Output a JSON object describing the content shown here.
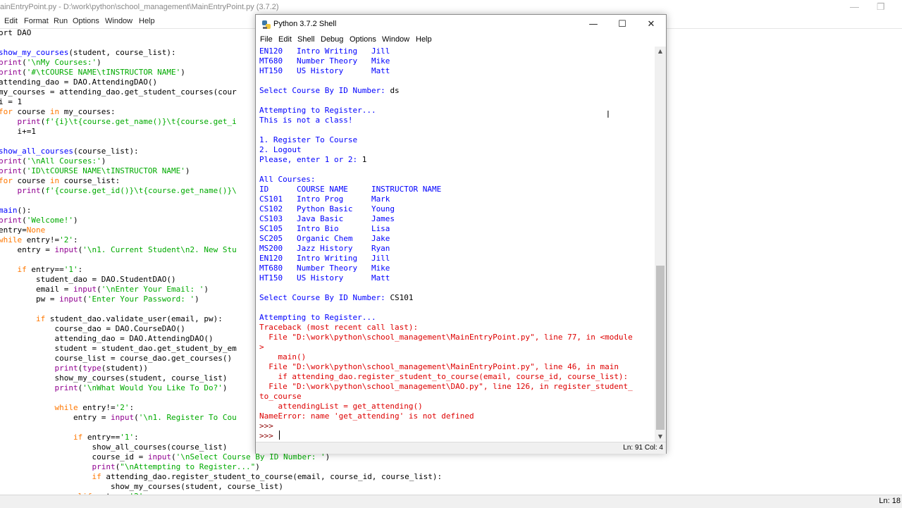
{
  "editor": {
    "title": "ainEntryPoint.py - D:\\work\\python\\school_management\\MainEntryPoint.py (3.7.2)",
    "window_controls": {
      "minimize": "—",
      "restore": "❐"
    },
    "menu": [
      "Edit",
      "Format",
      "Run",
      "Options",
      "Window",
      "Help"
    ],
    "code_lines": [
      [
        [
          "ort DAO",
          ""
        ]
      ],
      [
        [
          "",
          ""
        ]
      ],
      [
        [
          "show_my_courses",
          "df"
        ],
        [
          "(student, course_list):",
          ""
        ]
      ],
      [
        [
          "print",
          "bi"
        ],
        [
          "(",
          ""
        ],
        [
          "'\\nMy Courses:'",
          "st"
        ],
        [
          ")",
          ""
        ]
      ],
      [
        [
          "print",
          "bi"
        ],
        [
          "(",
          ""
        ],
        [
          "'#\\tCOURSE NAME\\tINSTRUCTOR NAME'",
          "st"
        ],
        [
          ")",
          ""
        ]
      ],
      [
        [
          "attending_dao = DAO.AttendingDAO()",
          ""
        ]
      ],
      [
        [
          "my_courses = attending_dao.get_student_courses(cour",
          ""
        ]
      ],
      [
        [
          "i = 1",
          ""
        ]
      ],
      [
        [
          "for",
          "kw"
        ],
        [
          " course ",
          ""
        ],
        [
          "in",
          "kw"
        ],
        [
          " my_courses:",
          ""
        ]
      ],
      [
        [
          "    ",
          ""
        ],
        [
          "print",
          "bi"
        ],
        [
          "(",
          ""
        ],
        [
          "f'{i}\\t{course.get_name()}\\t{course.get_i",
          "st"
        ]
      ],
      [
        [
          "    i+=1",
          ""
        ]
      ],
      [
        [
          "",
          ""
        ]
      ],
      [
        [
          "show_all_courses",
          "df"
        ],
        [
          "(course_list):",
          ""
        ]
      ],
      [
        [
          "print",
          "bi"
        ],
        [
          "(",
          ""
        ],
        [
          "'\\nAll Courses:'",
          "st"
        ],
        [
          ")",
          ""
        ]
      ],
      [
        [
          "print",
          "bi"
        ],
        [
          "(",
          ""
        ],
        [
          "'ID\\tCOURSE NAME\\tINSTRUCTOR NAME'",
          "st"
        ],
        [
          ")",
          ""
        ]
      ],
      [
        [
          "for",
          "kw"
        ],
        [
          " course ",
          ""
        ],
        [
          "in",
          "kw"
        ],
        [
          " course_list:",
          ""
        ]
      ],
      [
        [
          "    ",
          ""
        ],
        [
          "print",
          "bi"
        ],
        [
          "(",
          ""
        ],
        [
          "f'{course.get_id()}\\t{course.get_name()}\\",
          "st"
        ]
      ],
      [
        [
          "",
          ""
        ]
      ],
      [
        [
          "main",
          "df"
        ],
        [
          "():",
          ""
        ]
      ],
      [
        [
          "print",
          "bi"
        ],
        [
          "(",
          ""
        ],
        [
          "'Welcome!'",
          "st"
        ],
        [
          ")",
          ""
        ]
      ],
      [
        [
          "entry=",
          ""
        ],
        [
          "None",
          "kw"
        ]
      ],
      [
        [
          "while",
          "kw"
        ],
        [
          " entry!=",
          ""
        ],
        [
          "'2'",
          "st"
        ],
        [
          ":",
          ""
        ]
      ],
      [
        [
          "    entry = ",
          ""
        ],
        [
          "input",
          "bi"
        ],
        [
          "(",
          ""
        ],
        [
          "'\\n1. Current Student\\n2. New Stu",
          "st"
        ]
      ],
      [
        [
          "",
          ""
        ]
      ],
      [
        [
          "    ",
          ""
        ],
        [
          "if",
          "kw"
        ],
        [
          " entry==",
          ""
        ],
        [
          "'1'",
          "st"
        ],
        [
          ":",
          ""
        ]
      ],
      [
        [
          "        student_dao = DAO.StudentDAO()",
          ""
        ]
      ],
      [
        [
          "        email = ",
          ""
        ],
        [
          "input",
          "bi"
        ],
        [
          "(",
          ""
        ],
        [
          "'\\nEnter Your Email: '",
          "st"
        ],
        [
          ")",
          ""
        ]
      ],
      [
        [
          "        pw = ",
          ""
        ],
        [
          "input",
          "bi"
        ],
        [
          "(",
          ""
        ],
        [
          "'Enter Your Password: '",
          "st"
        ],
        [
          ")",
          ""
        ]
      ],
      [
        [
          "",
          ""
        ]
      ],
      [
        [
          "        ",
          ""
        ],
        [
          "if",
          "kw"
        ],
        [
          " student_dao.validate_user(email, pw):",
          ""
        ]
      ],
      [
        [
          "            course_dao = DAO.CourseDAO()",
          ""
        ]
      ],
      [
        [
          "            attending_dao = DAO.AttendingDAO()",
          ""
        ]
      ],
      [
        [
          "            student = student_dao.get_student_by_em",
          ""
        ]
      ],
      [
        [
          "            course_list = course_dao.get_courses()",
          ""
        ]
      ],
      [
        [
          "            ",
          ""
        ],
        [
          "print",
          "bi"
        ],
        [
          "(",
          ""
        ],
        [
          "type",
          "bi"
        ],
        [
          "(student))",
          ""
        ]
      ],
      [
        [
          "            show_my_courses(student, course_list)",
          ""
        ]
      ],
      [
        [
          "            ",
          ""
        ],
        [
          "print",
          "bi"
        ],
        [
          "(",
          ""
        ],
        [
          "'\\nWhat Would You Like To Do?'",
          "st"
        ],
        [
          ")",
          ""
        ]
      ],
      [
        [
          "",
          ""
        ]
      ],
      [
        [
          "            ",
          ""
        ],
        [
          "while",
          "kw"
        ],
        [
          " entry!=",
          ""
        ],
        [
          "'2'",
          "st"
        ],
        [
          ":",
          ""
        ]
      ],
      [
        [
          "                entry = ",
          ""
        ],
        [
          "input",
          "bi"
        ],
        [
          "(",
          ""
        ],
        [
          "'\\n1. Register To Cou",
          "st"
        ]
      ],
      [
        [
          "",
          ""
        ]
      ],
      [
        [
          "                ",
          ""
        ],
        [
          "if",
          "kw"
        ],
        [
          " entry==",
          ""
        ],
        [
          "'1'",
          "st"
        ],
        [
          ":",
          ""
        ]
      ],
      [
        [
          "                    show_all_courses(course_list)",
          ""
        ]
      ],
      [
        [
          "                    course_id = ",
          ""
        ],
        [
          "input",
          "bi"
        ],
        [
          "(",
          ""
        ],
        [
          "'\\nSelect Course By ID Number: '",
          "st"
        ],
        [
          ")",
          ""
        ]
      ],
      [
        [
          "                    ",
          ""
        ],
        [
          "print",
          "bi"
        ],
        [
          "(",
          ""
        ],
        [
          "\"\\nAttempting to Register...\"",
          "st"
        ],
        [
          ")",
          ""
        ]
      ],
      [
        [
          "                    ",
          ""
        ],
        [
          "if",
          "kw"
        ],
        [
          " attending_dao.register_student_to_course(email, course_id, course_list):",
          ""
        ]
      ],
      [
        [
          "                        show_my_courses(student, course_list)",
          ""
        ]
      ],
      [
        [
          "                ",
          ""
        ],
        [
          "elif",
          "kw"
        ],
        [
          " entry==",
          ""
        ],
        [
          "'2'",
          "st"
        ],
        [
          ":",
          ""
        ]
      ]
    ],
    "status_text": "Ln: 18"
  },
  "shell": {
    "title": "Python 3.7.2 Shell",
    "window_controls": {
      "minimize": "—",
      "maximize": "☐",
      "close": "✕"
    },
    "menu": [
      "File",
      "Edit",
      "Shell",
      "Debug",
      "Options",
      "Window",
      "Help"
    ],
    "output_lines": [
      [
        [
          "EN120   Intro Writing   Jill",
          "o"
        ]
      ],
      [
        [
          "MT680   Number Theory   Mike",
          "o"
        ]
      ],
      [
        [
          "HT150   US History      Matt",
          "o"
        ]
      ],
      [
        [
          "",
          ""
        ]
      ],
      [
        [
          "Select Course By ID Number: ",
          "o"
        ],
        [
          "ds",
          "ip"
        ]
      ],
      [
        [
          "",
          ""
        ]
      ],
      [
        [
          "Attempting to Register...",
          "o"
        ]
      ],
      [
        [
          "This is not a class!",
          "o"
        ]
      ],
      [
        [
          "",
          ""
        ]
      ],
      [
        [
          "1. Register To Course",
          "o"
        ]
      ],
      [
        [
          "2. Logout",
          "o"
        ]
      ],
      [
        [
          "Please, enter 1 or 2: ",
          "o"
        ],
        [
          "1",
          "ip"
        ]
      ],
      [
        [
          "",
          ""
        ]
      ],
      [
        [
          "All Courses:",
          "o"
        ]
      ],
      [
        [
          "ID      COURSE NAME     INSTRUCTOR NAME",
          "o"
        ]
      ],
      [
        [
          "CS101   Intro Prog      Mark",
          "o"
        ]
      ],
      [
        [
          "CS102   Python Basic    Young",
          "o"
        ]
      ],
      [
        [
          "CS103   Java Basic      James",
          "o"
        ]
      ],
      [
        [
          "SC105   Intro Bio       Lisa",
          "o"
        ]
      ],
      [
        [
          "SC205   Organic Chem    Jake",
          "o"
        ]
      ],
      [
        [
          "MS200   Jazz History    Ryan",
          "o"
        ]
      ],
      [
        [
          "EN120   Intro Writing   Jill",
          "o"
        ]
      ],
      [
        [
          "MT680   Number Theory   Mike",
          "o"
        ]
      ],
      [
        [
          "HT150   US History      Matt",
          "o"
        ]
      ],
      [
        [
          "",
          ""
        ]
      ],
      [
        [
          "Select Course By ID Number: ",
          "o"
        ],
        [
          "CS101",
          "ip"
        ]
      ],
      [
        [
          "",
          ""
        ]
      ],
      [
        [
          "Attempting to Register...",
          "o"
        ]
      ],
      [
        [
          "Traceback (most recent call last):",
          "er"
        ]
      ],
      [
        [
          "  File \"D:\\work\\python\\school_management\\MainEntryPoint.py\", line 77, in <module",
          "er"
        ]
      ],
      [
        [
          ">",
          "er"
        ]
      ],
      [
        [
          "    main()",
          "er"
        ]
      ],
      [
        [
          "  File \"D:\\work\\python\\school_management\\MainEntryPoint.py\", line 46, in main",
          "er"
        ]
      ],
      [
        [
          "    if attending_dao.register_student_to_course(email, course_id, course_list):",
          "er"
        ]
      ],
      [
        [
          "  File \"D:\\work\\python\\school_management\\DAO.py\", line 126, in register_student_",
          "er"
        ]
      ],
      [
        [
          "to_course",
          "er"
        ]
      ],
      [
        [
          "    attendingList = get_attending()",
          "er"
        ]
      ],
      [
        [
          "NameError: name 'get_attending' is not defined",
          "er"
        ]
      ],
      [
        [
          ">>>",
          "pr"
        ]
      ],
      [
        [
          ">>> ",
          "pr"
        ]
      ]
    ],
    "status_text": "Ln: 91  Col: 4"
  }
}
